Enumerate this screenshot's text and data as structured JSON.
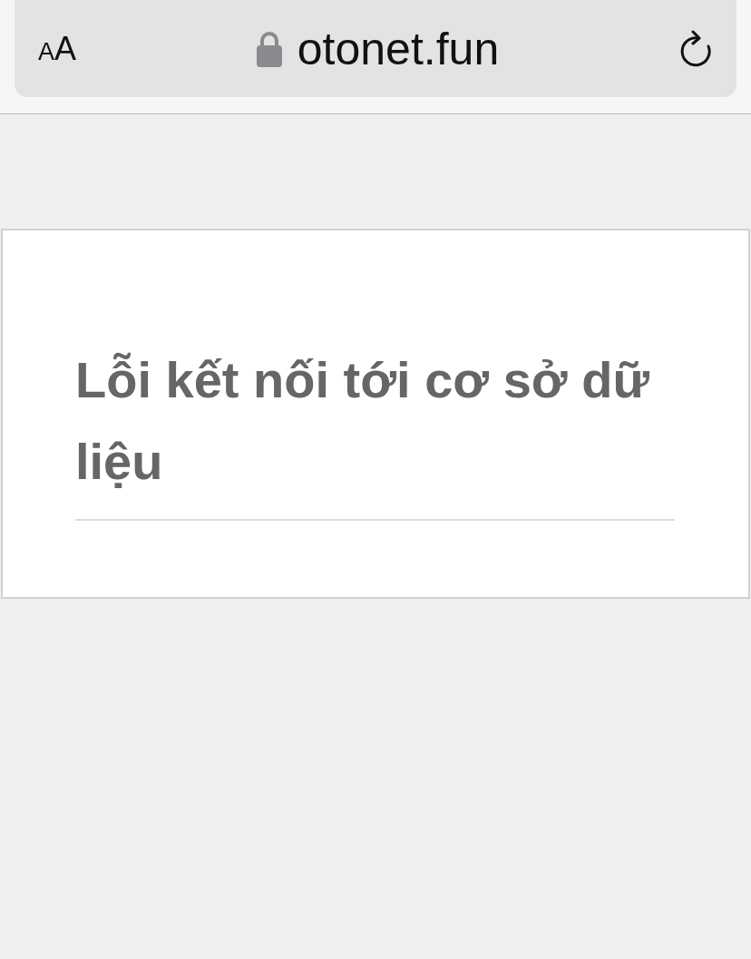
{
  "address_bar": {
    "text_size_button": "AA",
    "url": "otonet.fun",
    "secure": true
  },
  "error_card": {
    "title": "Lỗi kết nối tới cơ sở dữ liệu"
  }
}
